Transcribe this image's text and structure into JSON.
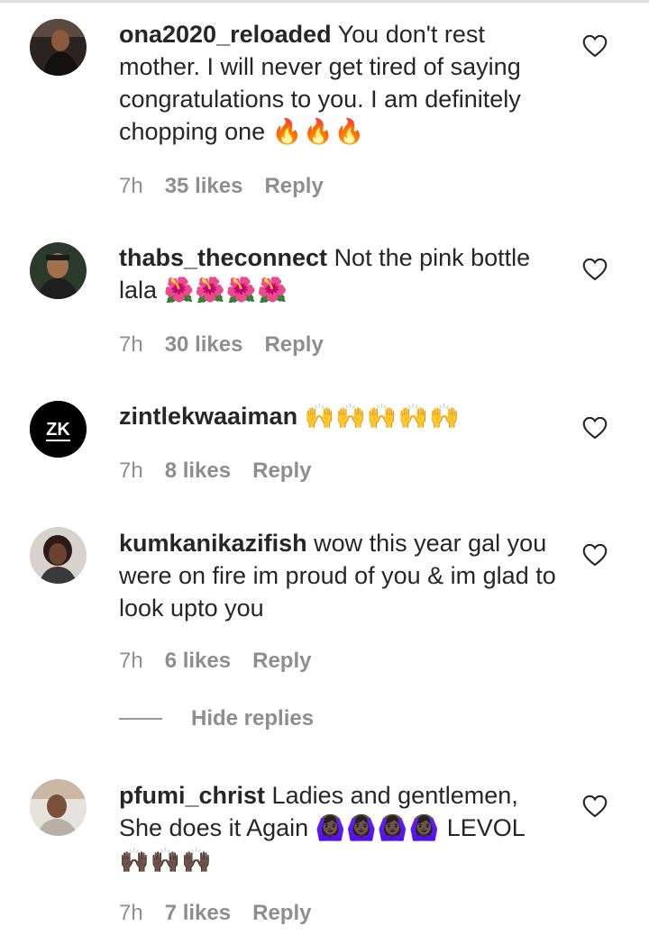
{
  "comments": [
    {
      "username": "ona2020_reloaded",
      "text": "You don't rest mother. I will never get tired of saying congratulations to you. I am definitely chopping one",
      "emoji": "🔥🔥🔥",
      "time": "7h",
      "likes": "35 likes",
      "reply": "Reply"
    },
    {
      "username": "thabs_theconnect",
      "text": "Not the pink bottle lala",
      "emoji": "🌺🌺🌺🌺",
      "time": "7h",
      "likes": "30 likes",
      "reply": "Reply"
    },
    {
      "username": "zintlekwaaiman",
      "text": "",
      "emoji": "🙌🙌🙌🙌🙌",
      "time": "7h",
      "likes": "8 likes",
      "reply": "Reply",
      "avatar_initials": "ZK"
    },
    {
      "username": "kumkanikazifish",
      "text": "wow this year gal you were on fire im proud of you & im glad to look upto you",
      "emoji": "",
      "time": "7h",
      "likes": "6 likes",
      "reply": "Reply"
    },
    {
      "username": "pfumi_christ",
      "text": "Ladies and gentlemen, She does it Again",
      "emoji": "🙆🏿‍♀️🙆🏿‍♀️🙆🏿‍♀️🙆🏿‍♀️",
      "text_after": "LEVOL",
      "emoji_after": "🙌🏿🙌🏿🙌🏿",
      "time": "7h",
      "likes": "7 likes",
      "reply": "Reply"
    }
  ],
  "hide_replies": "Hide replies",
  "colors": {
    "text": "#262626",
    "secondary": "#8e8e8e",
    "background": "#ffffff"
  },
  "icons": {
    "like": "heart-outline-icon"
  }
}
